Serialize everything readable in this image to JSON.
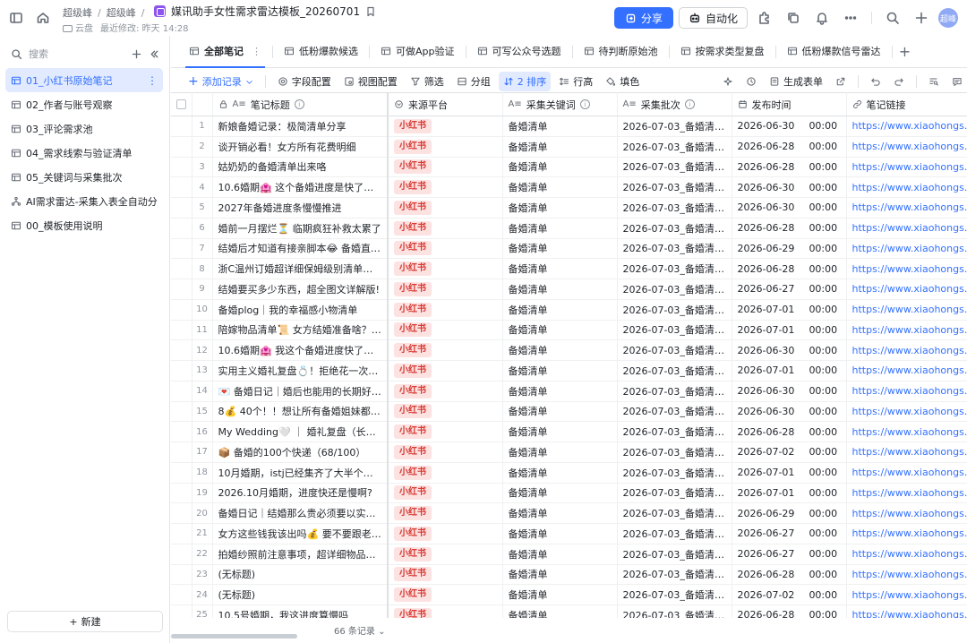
{
  "header": {
    "breadcrumb": [
      "超级峰",
      "超级峰"
    ],
    "doc_title": "媒讯助手女性需求雷达模板_20260701",
    "location": "云盘",
    "last_modified": "最近修改: 昨天 14:28",
    "share_label": "分享",
    "automation_label": "自动化",
    "avatar_text": "超峰"
  },
  "sidebar": {
    "search_placeholder": "搜索",
    "items": [
      {
        "label": "01_小红书原始笔记",
        "active": true
      },
      {
        "label": "02_作者与账号观察"
      },
      {
        "label": "03_评论需求池"
      },
      {
        "label": "04_需求线索与验证清单"
      },
      {
        "label": "05_关键词与采集批次"
      },
      {
        "label": "AI需求雷达-采集入表全自动分析"
      },
      {
        "label": "00_模板使用说明"
      }
    ],
    "new_label": "新建"
  },
  "views": {
    "tabs": [
      {
        "label": "全部笔记",
        "active": true
      },
      {
        "label": "低粉爆款候选"
      },
      {
        "label": "可做App验证"
      },
      {
        "label": "可写公众号选题"
      },
      {
        "label": "待判断原始池"
      },
      {
        "label": "按需求类型复盘"
      },
      {
        "label": "低粉爆款信号雷达"
      }
    ]
  },
  "toolbar": {
    "add_record": "添加记录",
    "field_config": "字段配置",
    "view_config": "视图配置",
    "filter": "筛选",
    "group": "分组",
    "sort": "2 排序",
    "row_height": "行高",
    "fill_color": "填色",
    "generate_form": "生成表单"
  },
  "table": {
    "columns": [
      "笔记标题",
      "来源平台",
      "采集关键词",
      "采集批次",
      "发布时间",
      "笔记链接"
    ],
    "rows": [
      {
        "n": "1",
        "title": "新娘备婚记录：极简清单分享",
        "platform": "小红书",
        "keyword": "备婚清单",
        "batch": "2026-07-03_备婚清单...",
        "date": "2026-06-30",
        "time": "00:00",
        "link": "https://www.xiaohongs..."
      },
      {
        "n": "2",
        "title": "谈开销必看！女方所有花费明细",
        "platform": "小红书",
        "keyword": "备婚清单",
        "batch": "2026-07-03_备婚清单...",
        "date": "2026-06-28",
        "time": "00:00",
        "link": "https://www.xiaohongs..."
      },
      {
        "n": "3",
        "title": "姑奶奶的备婚清单出来咯",
        "platform": "小红书",
        "keyword": "备婚清单",
        "batch": "2026-07-03_备婚清单...",
        "date": "2026-06-28",
        "time": "00:00",
        "link": "https://www.xiaohongs..."
      },
      {
        "n": "4",
        "title": "10.6婚期🏩 这个备婚进度是快了还是慢...",
        "platform": "小红书",
        "keyword": "备婚清单",
        "batch": "2026-07-03_备婚清单...",
        "date": "2026-06-30",
        "time": "00:00",
        "link": "https://www.xiaohongs..."
      },
      {
        "n": "5",
        "title": "2027年备婚进度条慢慢推进",
        "platform": "小红书",
        "keyword": "备婚清单",
        "batch": "2026-07-03_备婚清单...",
        "date": "2026-06-30",
        "time": "00:00",
        "link": "https://www.xiaohongs..."
      },
      {
        "n": "6",
        "title": "婚前一月摆烂⏳ 临期疯狂补救太累了",
        "platform": "小红书",
        "keyword": "备婚清单",
        "batch": "2026-07-03_备婚清单...",
        "date": "2026-06-28",
        "time": "00:00",
        "link": "https://www.xiaohongs..."
      },
      {
        "n": "7",
        "title": "结婚后才知道有接亲脚本😂 备婚直接抄...",
        "platform": "小红书",
        "keyword": "备婚清单",
        "batch": "2026-07-03_备婚清单...",
        "date": "2026-06-29",
        "time": "00:00",
        "link": "https://www.xiaohongs..."
      },
      {
        "n": "8",
        "title": "浙C温州订婚超详细保姆级别清单！！！",
        "platform": "小红书",
        "keyword": "备婚清单",
        "batch": "2026-07-03_备婚清单...",
        "date": "2026-06-28",
        "time": "00:00",
        "link": "https://www.xiaohongs..."
      },
      {
        "n": "9",
        "title": "结婚要买多少东西，超全图文详解版!",
        "platform": "小红书",
        "keyword": "备婚清单",
        "batch": "2026-07-03_备婚清单...",
        "date": "2026-06-27",
        "time": "00:00",
        "link": "https://www.xiaohongs..."
      },
      {
        "n": "10",
        "title": "备婚plog｜我的幸福感小物清单",
        "platform": "小红书",
        "keyword": "备婚清单",
        "batch": "2026-07-03_备婚清单...",
        "date": "2026-07-01",
        "time": "00:00",
        "link": "https://www.xiaohongs..."
      },
      {
        "n": "11",
        "title": "陪嫁物品清单📜 女方结婚准备啥？看这...",
        "platform": "小红书",
        "keyword": "备婚清单",
        "batch": "2026-07-03_备婚清单...",
        "date": "2026-07-01",
        "time": "00:00",
        "link": "https://www.xiaohongs..."
      },
      {
        "n": "12",
        "title": "10.6婚期🏩 我这个备婚进度快了还是慢...",
        "platform": "小红书",
        "keyword": "备婚清单",
        "batch": "2026-07-03_备婚清单...",
        "date": "2026-06-30",
        "time": "00:00",
        "link": "https://www.xiaohongs..."
      },
      {
        "n": "13",
        "title": "实用主义婚礼复盘💍！拒绝花一次性的...",
        "platform": "小红书",
        "keyword": "备婚清单",
        "batch": "2026-07-03_备婚清单...",
        "date": "2026-07-01",
        "time": "00:00",
        "link": "https://www.xiaohongs..."
      },
      {
        "n": "14",
        "title": "💌 备婚日记｜婚后也能用的长期好物！🌹",
        "platform": "小红书",
        "keyword": "备婚清单",
        "batch": "2026-07-03_备婚清单...",
        "date": "2026-06-30",
        "time": "00:00",
        "link": "https://www.xiaohongs..."
      },
      {
        "n": "15",
        "title": "8💰 40个！！想让所有备婚姐妹都知道...",
        "platform": "小红书",
        "keyword": "备婚清单",
        "batch": "2026-07-03_备婚清单...",
        "date": "2026-06-30",
        "time": "00:00",
        "link": "https://www.xiaohongs..."
      },
      {
        "n": "16",
        "title": "My Wedding🤍 ｜ 婚礼复盘（长期主义...",
        "platform": "小红书",
        "keyword": "备婚清单",
        "batch": "2026-07-03_备婚清单...",
        "date": "2026-06-28",
        "time": "00:00",
        "link": "https://www.xiaohongs..."
      },
      {
        "n": "17",
        "title": "📦 备婚的100个快递（68/100）",
        "platform": "小红书",
        "keyword": "备婚清单",
        "batch": "2026-07-03_备婚清单...",
        "date": "2026-07-02",
        "time": "00:00",
        "link": "https://www.xiaohongs..."
      },
      {
        "n": "18",
        "title": "10月婚期，istj已经集齐了大半个婚礼的...",
        "platform": "小红书",
        "keyword": "备婚清单",
        "batch": "2026-07-03_备婚清单...",
        "date": "2026-07-01",
        "time": "00:00",
        "link": "https://www.xiaohongs..."
      },
      {
        "n": "19",
        "title": "2026.10月婚期，进度快还是慢啊?",
        "platform": "小红书",
        "keyword": "备婚清单",
        "batch": "2026-07-03_备婚清单...",
        "date": "2026-07-01",
        "time": "00:00",
        "link": "https://www.xiaohongs..."
      },
      {
        "n": "20",
        "title": "备婚日记｜结婚那么贵必须要以实用为...",
        "platform": "小红书",
        "keyword": "备婚清单",
        "batch": "2026-07-03_备婚清单...",
        "date": "2026-06-29",
        "time": "00:00",
        "link": "https://www.xiaohongs..."
      },
      {
        "n": "21",
        "title": "女方这些钱我该出吗💰 要不要跟老公商量",
        "platform": "小红书",
        "keyword": "备婚清单",
        "batch": "2026-07-03_备婚清单...",
        "date": "2026-06-27",
        "time": "00:00",
        "link": "https://www.xiaohongs..."
      },
      {
        "n": "22",
        "title": "拍婚纱照前注意事项，超详细物品清单",
        "platform": "小红书",
        "keyword": "备婚清单",
        "batch": "2026-07-03_备婚清单...",
        "date": "2026-06-27",
        "time": "00:00",
        "link": "https://www.xiaohongs..."
      },
      {
        "n": "23",
        "title": "(无标题)",
        "platform": "小红书",
        "keyword": "备婚清单",
        "batch": "2026-07-03_备婚清单...",
        "date": "2026-06-28",
        "time": "00:00",
        "link": "https://www.xiaohongs..."
      },
      {
        "n": "24",
        "title": "(无标题)",
        "platform": "小红书",
        "keyword": "备婚清单",
        "batch": "2026-07-03_备婚清单...",
        "date": "2026-07-02",
        "time": "00:00",
        "link": "https://www.xiaohongs..."
      },
      {
        "n": "25",
        "title": "10.5号婚期，我这进度算慢吗",
        "platform": "小红书",
        "keyword": "备婚清单",
        "batch": "2026-07-03_备婚清单...",
        "date": "2026-06-28",
        "time": "00:00",
        "link": "https://www.xiaohongs..."
      }
    ],
    "record_count": "66 条记录"
  },
  "colors": {
    "accent": "#3370ff",
    "tag_bg": "#fde2e2",
    "tag_text": "#d83931",
    "active_bg": "#e1eaff"
  }
}
